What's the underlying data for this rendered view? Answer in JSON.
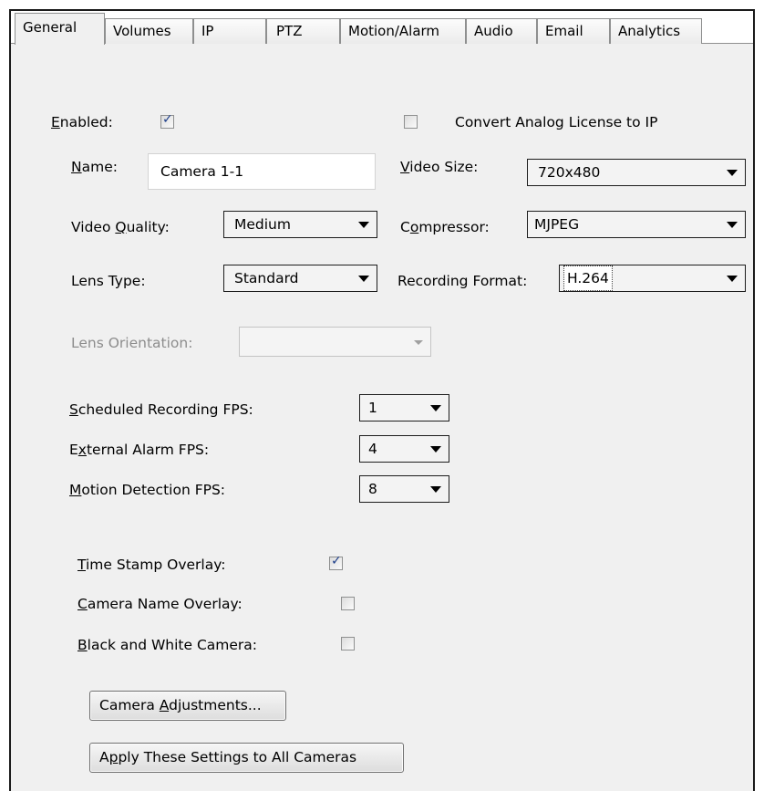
{
  "tabs": [
    {
      "label": "General"
    },
    {
      "label": "Volumes"
    },
    {
      "label": "IP"
    },
    {
      "label": "PTZ"
    },
    {
      "label": "Motion/Alarm"
    },
    {
      "label": "Audio"
    },
    {
      "label": "Email"
    },
    {
      "label": "Analytics"
    }
  ],
  "general": {
    "enabled": {
      "mnemonic": "E",
      "rest": "nabled:",
      "checked": true
    },
    "convert_license": {
      "label": "Convert Analog License to IP",
      "checked": false
    },
    "name": {
      "mnemonic": "N",
      "rest": "ame:",
      "value": "Camera 1-1"
    },
    "video_size": {
      "mnemonic": "V",
      "rest": "ideo Size:",
      "value": "720x480"
    },
    "video_quality": {
      "pre": "Video ",
      "mnemonic": "Q",
      "rest": "uality:",
      "value": "Medium"
    },
    "compressor": {
      "pre": "C",
      "mnemonic": "o",
      "rest": "mpressor:",
      "value": "MJPEG"
    },
    "lens_type": {
      "label": "Lens Type:",
      "value": "Standard"
    },
    "recording_format": {
      "label": "Recording Format:",
      "value": "H.264"
    },
    "lens_orientation": {
      "label": "Lens Orientation:",
      "value": ""
    },
    "scheduled_fps": {
      "mnemonic": "S",
      "rest": "cheduled Recording FPS:",
      "value": "1"
    },
    "external_fps": {
      "pre": "E",
      "mnemonic": "x",
      "rest": "ternal Alarm FPS:",
      "value": "4"
    },
    "motion_fps": {
      "mnemonic": "M",
      "rest": "otion Detection FPS:",
      "value": "8"
    },
    "timestamp_overlay": {
      "mnemonic": "T",
      "rest": "ime Stamp Overlay:",
      "checked": true
    },
    "camera_name_overlay": {
      "mnemonic": "C",
      "rest": "amera Name Overlay:",
      "checked": false
    },
    "bw_camera": {
      "mnemonic": "B",
      "rest": "lack and White Camera:",
      "checked": false
    },
    "camera_adjustments_btn": {
      "pre": "Camera ",
      "mnemonic": "A",
      "rest": "djustments..."
    },
    "apply_all_btn": {
      "pre": "A",
      "mnemonic": "p",
      "rest": "ply These Settings to All Cameras"
    }
  },
  "icons": {
    "check": "checkmark-icon",
    "dropdown": "chevron-down-icon"
  }
}
